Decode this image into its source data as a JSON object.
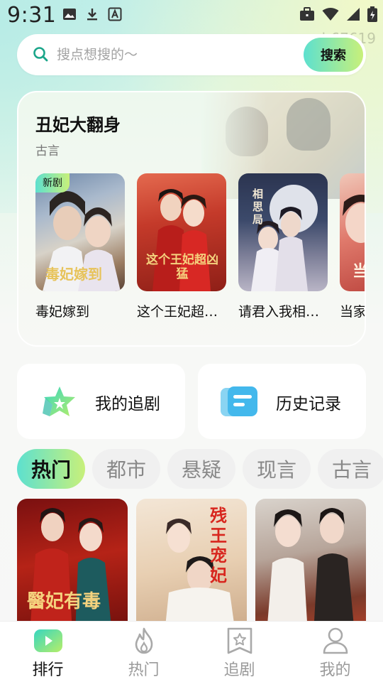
{
  "status_bar": {
    "time": "9:31",
    "watermark": "b67619",
    "left_icons": [
      "gallery-icon",
      "download-icon",
      "keyboard-a-icon"
    ],
    "right_icons": [
      "briefcase-icon",
      "wifi-icon",
      "signal-icon",
      "battery-icon"
    ]
  },
  "search": {
    "placeholder": "搜点想搜的～",
    "button_label": "搜索"
  },
  "featured": {
    "title": "丑妃大翻身",
    "genre": "古言",
    "items": [
      {
        "caption": "毒妃嫁到",
        "badge": "新剧",
        "poster_text": "毒妃嫁到"
      },
      {
        "caption": "这个王妃超…",
        "poster_text": "这个王妃超凶猛"
      },
      {
        "caption": "请君入我相…",
        "poster_text": "相思局"
      },
      {
        "caption": "当家",
        "poster_text": "当"
      }
    ]
  },
  "quick_links": [
    {
      "label": "我的追剧",
      "icon": "star-icon"
    },
    {
      "label": "历史记录",
      "icon": "history-card-icon"
    }
  ],
  "categories": {
    "active_index": 0,
    "items": [
      "热门",
      "都市",
      "悬疑",
      "现言",
      "古言"
    ]
  },
  "grid": [
    {
      "poster_text": "醫妃有毒"
    },
    {
      "poster_text": "残王宠妃"
    },
    {
      "poster_text": ""
    }
  ],
  "bottom_nav": {
    "active_index": 0,
    "items": [
      {
        "label": "排行",
        "icon": "play-icon"
      },
      {
        "label": "热门",
        "icon": "flame-icon"
      },
      {
        "label": "追剧",
        "icon": "bookmark-star-icon"
      },
      {
        "label": "我的",
        "icon": "person-icon"
      }
    ]
  },
  "colors": {
    "accent_start": "#5de0cf",
    "accent_end": "#c8f07a",
    "search_icon": "#1aa589"
  }
}
